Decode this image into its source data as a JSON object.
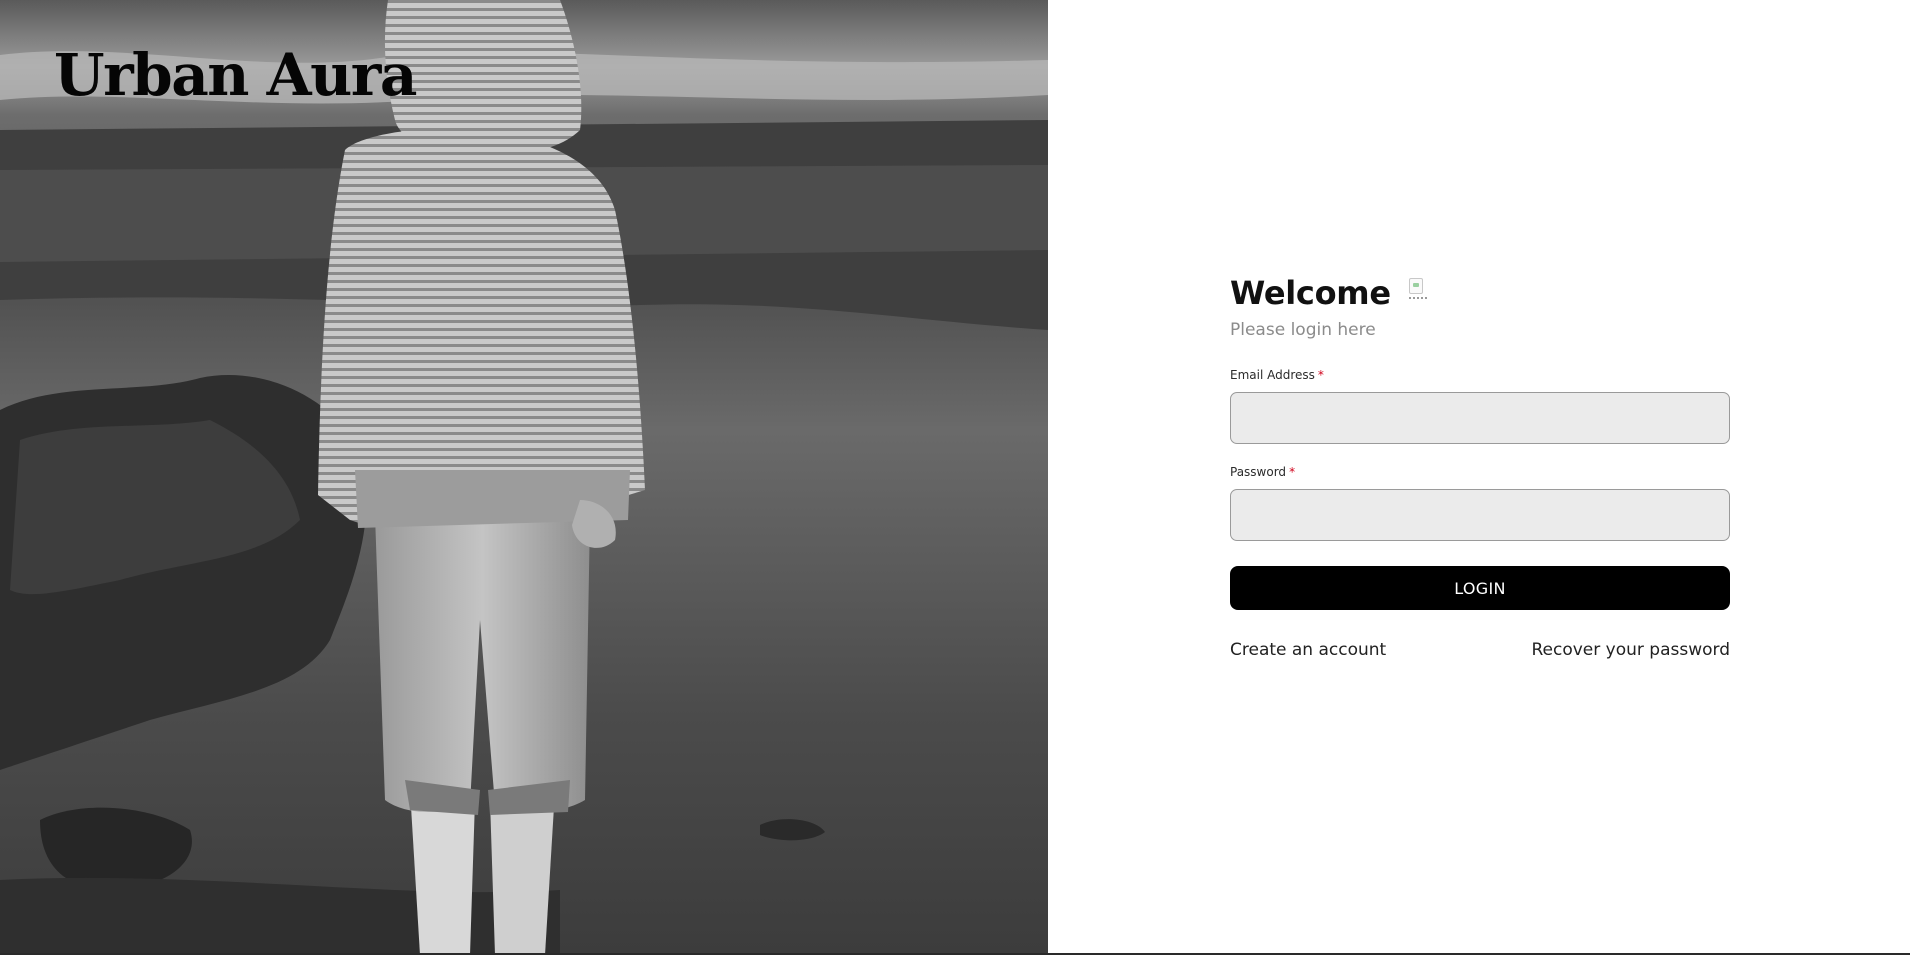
{
  "brand": {
    "name": "Urban Aura"
  },
  "hero": {
    "image": "grayscale-child-at-shoreline"
  },
  "login": {
    "heading": "Welcome",
    "heading_icon": "broken-image-icon",
    "subtitle": "Please login here",
    "email": {
      "label": "Email Address",
      "required_mark": "*",
      "value": "",
      "placeholder": ""
    },
    "password": {
      "label": "Password",
      "required_mark": "*",
      "value": "",
      "placeholder": ""
    },
    "submit_label": "LOGIN",
    "create_account_label": "Create an account",
    "recover_password_label": "Recover your password"
  },
  "colors": {
    "button_bg": "#000000",
    "button_text": "#ffffff",
    "input_bg": "#ebebeb",
    "required": "#d0021b",
    "subtitle": "#8b8b8b"
  }
}
